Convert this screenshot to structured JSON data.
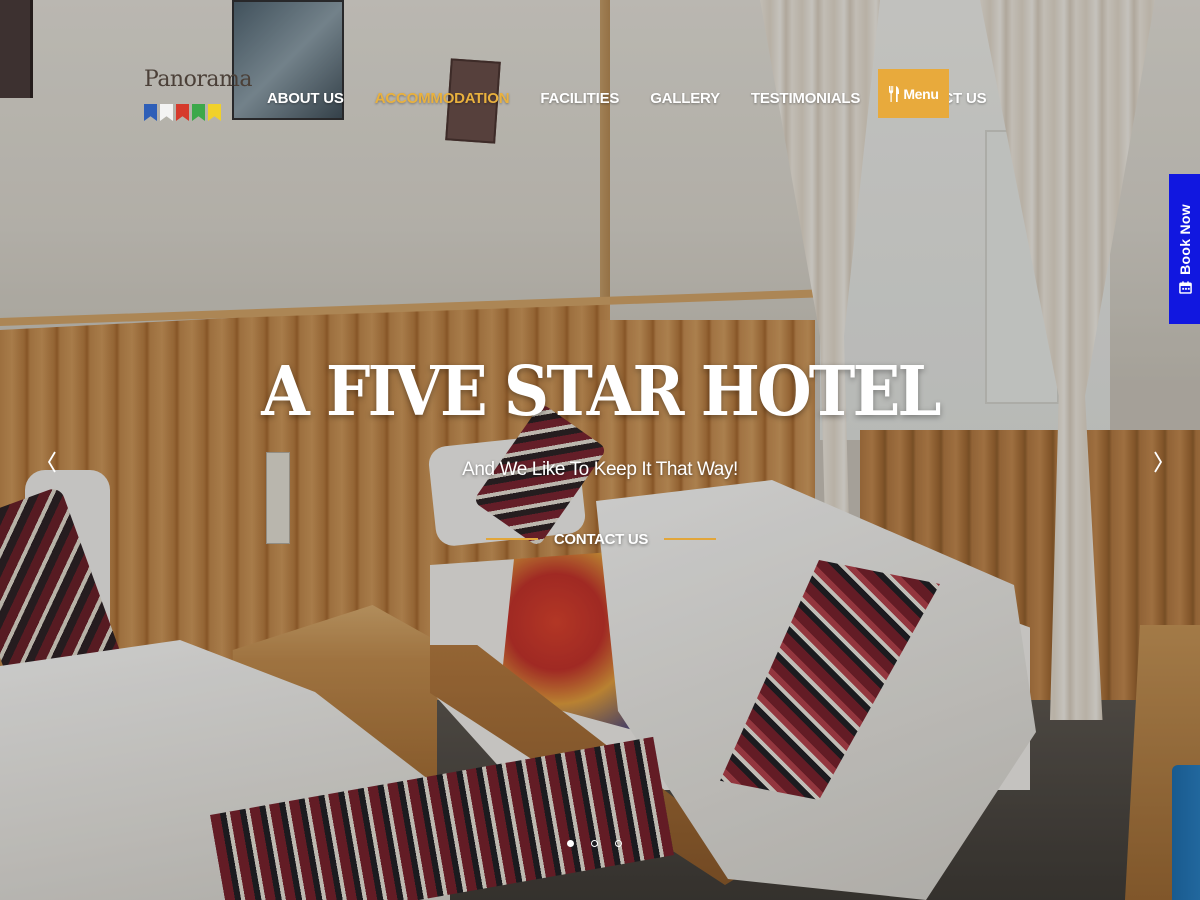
{
  "logo": {
    "text": "Panorama",
    "flag_colors": [
      "#2f5fb8",
      "#f3f3f3",
      "#d63a2c",
      "#3ca84a",
      "#f0d12a"
    ]
  },
  "nav": {
    "items": [
      {
        "label": "ABOUT US",
        "active": false
      },
      {
        "label": "ACCOMMODATION",
        "active": true
      },
      {
        "label": "FACILITIES",
        "active": false
      },
      {
        "label": "GALLERY",
        "active": false
      },
      {
        "label": "TESTIMONIALS",
        "active": false
      },
      {
        "label": "CONTACT US",
        "active": false
      }
    ],
    "menu_button": {
      "label": "Menu",
      "icon": "fork-knife-icon"
    }
  },
  "book_now": {
    "label": "Book Now",
    "icon": "calendar-icon"
  },
  "hero": {
    "title": "A FIVE STAR HOTEL",
    "subtitle": "And We Like To Keep It That Way!",
    "cta_label": "CONTACT US"
  },
  "slider": {
    "prev_icon": "chevron-left-icon",
    "next_icon": "chevron-right-icon",
    "slide_count": 3,
    "active_slide": 1
  },
  "colors": {
    "accent": "#e8aa3c",
    "active_nav": "#e9b13e",
    "book_now_bg": "#1117e0",
    "text": "#ffffff"
  }
}
